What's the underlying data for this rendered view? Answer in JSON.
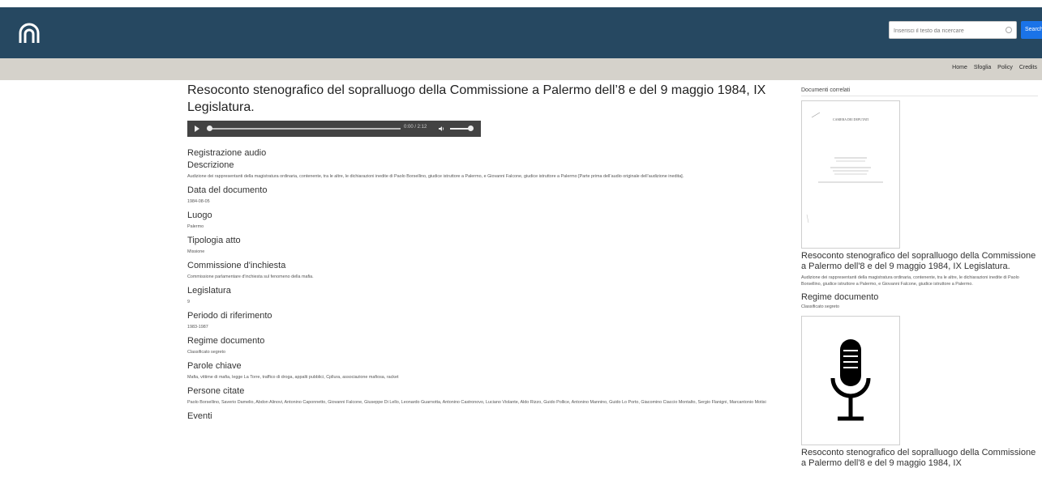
{
  "header": {
    "logo": "cnr-logo-icon",
    "search": {
      "placeholder": "Inserisci il testo da ricercare",
      "button_label": "Search"
    }
  },
  "nav": {
    "items": [
      "Home",
      "Sfoglia",
      "Policy",
      "Credits"
    ]
  },
  "document": {
    "title": "Resoconto stenografico del sopralluogo della Commissione a Palermo dell’8 e del 9 maggio 1984, IX Legislatura.",
    "audio": {
      "time": "0:00 / 2:12"
    },
    "audio_heading": "Registrazione audio",
    "fields": [
      {
        "label": "Descrizione",
        "value": "Audizione dei rappresentanti della magistratura ordinaria, contenente, tra le altre, le dichiarazioni inedite di Paolo Borsellino, giudice istruttore a Palermo, e Giovanni Falcone, giudice istruttore a Palermo [Parte prima dell’audio originale dell’audizione inedita]."
      },
      {
        "label": "Data del documento",
        "value": "1984-08-05"
      },
      {
        "label": "Luogo",
        "value": "Palermo"
      },
      {
        "label": "Tipologia atto",
        "value": "Missione"
      },
      {
        "label": "Commissione d'inchiesta",
        "value": "Commissione parlamentare d'inchiesta sul fenomeno della mafia."
      },
      {
        "label": "Legislatura",
        "value": "9"
      },
      {
        "label": "Periodo di riferimento",
        "value": "1983-1987"
      },
      {
        "label": "Regime documento",
        "value": "Classificato segreto"
      },
      {
        "label": "Parole chiave",
        "value": "Mafia, vittime di mafia, legge La Torre, traffico di droga, appalti pubblici, Cpllura, associazione mafiosa, racket"
      },
      {
        "label": "Persone citate",
        "value": "Paolo Borsellino, Saverio Damelio, Abdon Alinovi, Antonino Caponnetto, Giovanni Falcone, Giuseppe Di Lello, Leonardo Guarnotta, Antonino Castronovo, Luciano Violante, Aldo Rizzo, Guido Pollice, Antonino Mannino, Guido Lo Porto, Giacomino Ciaccio Montalto, Sergio Flanigni, Marcantonio Motisi"
      },
      {
        "label": "Eventi",
        "value": ""
      }
    ]
  },
  "sidebar": {
    "title": "Documenti correlati",
    "items": [
      {
        "thumb_header": "CAMERA DEI DEPUTATI",
        "title": "Resoconto stenografico del sopralluogo della Commissione a Palermo dell'8 e del 9 maggio 1984, IX Legislatura.",
        "desc": "Audizione dei rappresentanti della magistratura ordinaria, contenente, tra le altre, le dichiarazioni inedite di Paolo Borsellino, giudice istruttore a Palermo, e Giovanni Falcone, giudice istruttore a Palermo.",
        "regime_label": "Regime documento",
        "regime_value": "Classificato segreto"
      },
      {
        "title": "Resoconto stenografico del sopralluogo della Commissione a Palermo dell'8 e del 9 maggio 1984, IX"
      }
    ]
  },
  "colors": {
    "header_bg": "#264861",
    "navbar_bg": "#d5d2cb",
    "search_button": "#1a73e8",
    "player_bg": "#434343"
  }
}
